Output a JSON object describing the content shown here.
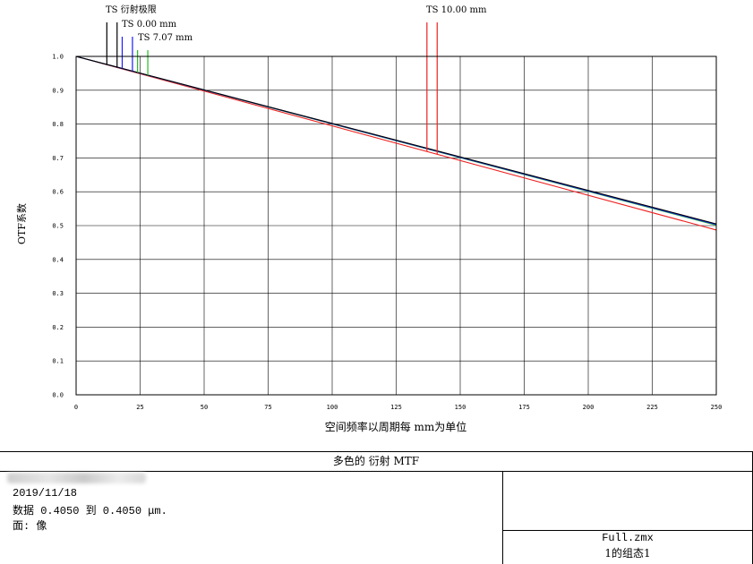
{
  "chart_data": {
    "type": "line",
    "title": "多色的 衍射 MTF",
    "xlabel": "空间频率以周期每 mm为单位",
    "ylabel": "OTF系数",
    "xlim": [
      0,
      250
    ],
    "ylim": [
      0,
      1.0
    ],
    "x_ticks": [
      "0",
      "25",
      "50",
      "75",
      "100",
      "125",
      "150",
      "175",
      "200",
      "225",
      "250"
    ],
    "y_ticks": [
      "0.0",
      "0.1",
      "0.2",
      "0.3",
      "0.4",
      "0.5",
      "0.6",
      "0.7",
      "0.8",
      "0.9",
      "1.0"
    ],
    "grid": true,
    "legend_position": "top",
    "legend": [
      {
        "label": "TS 衍射极限",
        "color": "#000000",
        "lines": 2
      },
      {
        "label": "TS 0.00 mm",
        "color": "#1a1aff",
        "lines": 2
      },
      {
        "label": "TS 7.07 mm",
        "color": "#22bb22",
        "lines": 2
      },
      {
        "label": "TS 10.00 mm",
        "color": "#ee2222",
        "lines": 2
      }
    ],
    "series": [
      {
        "name": "TS 衍射极限",
        "color": "#000000",
        "x": [
          0,
          250
        ],
        "y": [
          1.0,
          0.505
        ]
      },
      {
        "name": "TS 0.00 mm",
        "color": "#1a1aff",
        "x": [
          0,
          250
        ],
        "y": [
          1.0,
          0.503
        ]
      },
      {
        "name": "TS 7.07 mm",
        "color": "#22bb22",
        "x": [
          0,
          250
        ],
        "y": [
          1.0,
          0.501
        ]
      },
      {
        "name": "TS 10.00 mm",
        "color": "#ee2222",
        "x": [
          0,
          250
        ],
        "y": [
          1.0,
          0.487
        ]
      }
    ]
  },
  "info": {
    "date": "2019/11/18",
    "data_line": "数据 0.4050 到 0.4050 μm.",
    "surface_line": "面: 像"
  },
  "file": {
    "name": "Full.zmx",
    "config": "1的组态1"
  }
}
